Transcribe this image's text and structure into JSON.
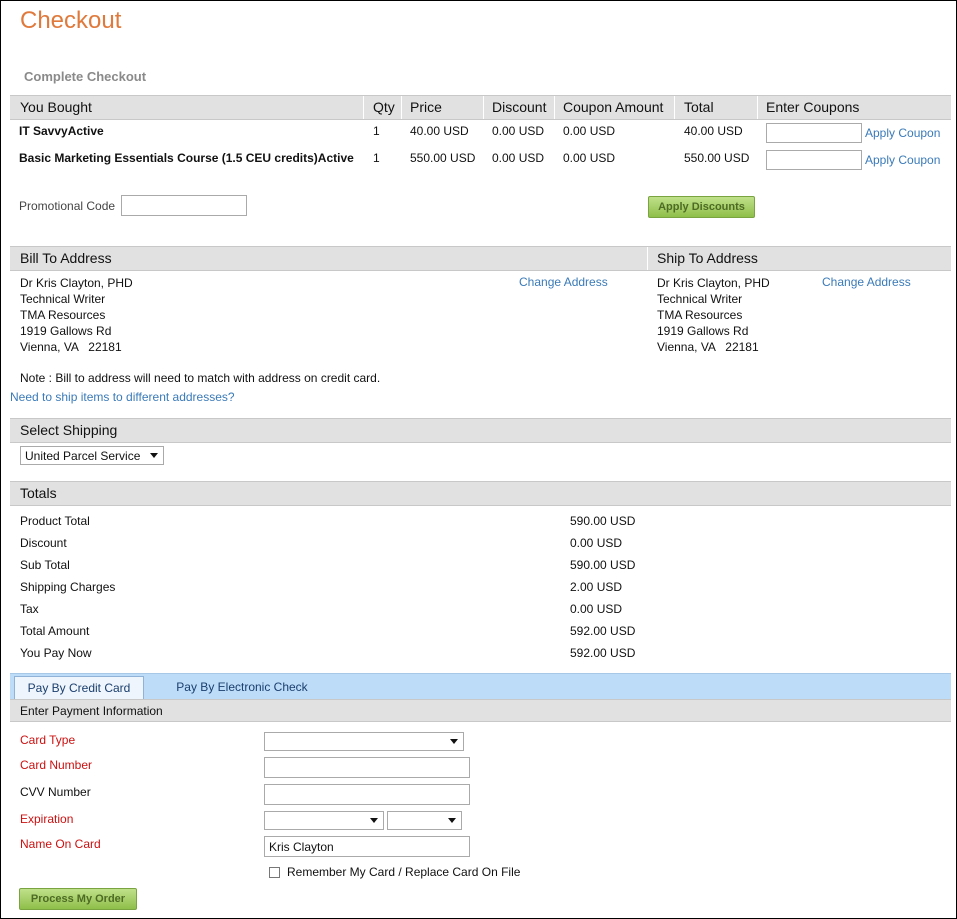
{
  "page": {
    "title": "Checkout",
    "subtitle": "Complete Checkout"
  },
  "cart": {
    "headers": [
      "You Bought",
      "Qty",
      "Price",
      "Discount",
      "Coupon Amount",
      "Total",
      "Enter Coupons"
    ],
    "items": [
      {
        "name": "IT SavvyActive",
        "qty": "1",
        "price": "40.00 USD",
        "discount": "0.00 USD",
        "coupon_amount": "0.00 USD",
        "total": "40.00 USD",
        "coupon_value": "",
        "apply_label": "Apply Coupon"
      },
      {
        "name": "Basic Marketing Essentials Course (1.5 CEU credits)Active",
        "qty": "1",
        "price": "550.00 USD",
        "discount": "0.00 USD",
        "coupon_amount": "0.00 USD",
        "total": "550.00 USD",
        "coupon_value": "",
        "apply_label": "Apply Coupon"
      }
    ],
    "promo_label": "Promotional Code",
    "promo_value": "",
    "apply_discounts_label": "Apply Discounts"
  },
  "addresses": {
    "bill_header": "Bill To Address",
    "ship_header": "Ship To Address",
    "change_label": "Change Address",
    "bill_lines": [
      "Dr Kris Clayton, PHD",
      "Technical Writer",
      "TMA Resources",
      "1919 Gallows Rd",
      "Vienna, VA   22181"
    ],
    "ship_lines": [
      "Dr Kris Clayton, PHD",
      "Technical Writer",
      "TMA Resources",
      "1919 Gallows Rd",
      "Vienna, VA   22181"
    ],
    "note": "Note : Bill to address will need to match with address on credit card.",
    "multi_ship_link": "Need to ship items to different addresses?"
  },
  "shipping": {
    "header": "Select Shipping",
    "selected": "United Parcel Service"
  },
  "totals": {
    "header": "Totals",
    "rows": [
      {
        "label": "Product Total",
        "value": "590.00 USD"
      },
      {
        "label": "Discount",
        "value": "0.00 USD"
      },
      {
        "label": "Sub Total",
        "value": "590.00 USD"
      },
      {
        "label": "Shipping Charges",
        "value": "2.00 USD"
      },
      {
        "label": "Tax",
        "value": "0.00 USD"
      },
      {
        "label": "Total Amount",
        "value": "592.00 USD"
      },
      {
        "label": "You Pay Now",
        "value": "592.00 USD"
      }
    ]
  },
  "payment": {
    "tabs": [
      "Pay By Credit Card",
      "Pay By Electronic Check"
    ],
    "active_tab": 0,
    "header": "Enter Payment Information",
    "card_type_label": "Card Type",
    "card_type_value": "",
    "card_number_label": "Card Number",
    "card_number_value": "",
    "cvv_label": "CVV Number",
    "cvv_value": "",
    "expiration_label": "Expiration",
    "exp_month": "",
    "exp_year": "",
    "name_label": "Name On Card",
    "name_value": "Kris Clayton",
    "remember_label": "Remember My Card / Replace Card On File",
    "remember_checked": false,
    "submit_label": "Process My Order"
  },
  "colors": {
    "title": "#e07a3c",
    "link": "#3a7ab8",
    "required_label": "#cc1111",
    "header_bar": "#e1e1e1",
    "tab_bar": "#bcdcf8",
    "button_green": "#a6d06a"
  }
}
